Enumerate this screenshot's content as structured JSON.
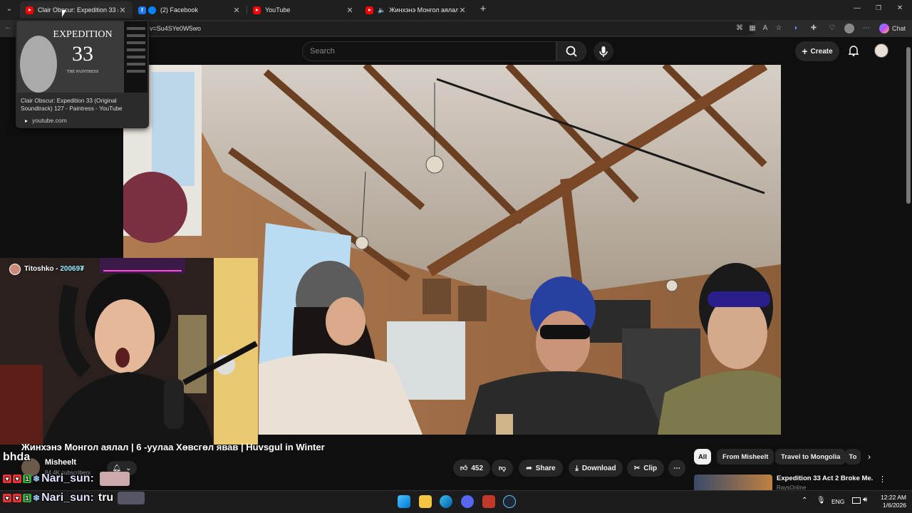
{
  "browser": {
    "tabs": [
      {
        "title": "Clair Obscur: Expedition 33 (Origin",
        "icon": "youtube-icon"
      },
      {
        "title": "(2) Facebook",
        "icon": "facebook-icon"
      },
      {
        "title": "YouTube",
        "icon": "youtube-icon"
      },
      {
        "title": "Жинхэнэ Монгол аялал | 6 -у",
        "icon": "youtube-icon",
        "audio": true
      }
    ],
    "url": "v=Su4SYe0W5wo",
    "chat_label": "Chat",
    "tab_preview": {
      "title": "Clair Obscur: Expedition 33 (Original Soundtrack) 127 - Paintress - YouTube",
      "domain": "youtube.com",
      "album_word": "EXPEDITION",
      "album_num": "33",
      "album_sub": "THE PAINTRESS"
    }
  },
  "youtube": {
    "search_placeholder": "Search",
    "create_label": "Create",
    "video_title": "Жинхэнэ Монгол аялал | 6 -уулаа Хөвсгөл явав | Huvsgul in Winter",
    "channel": "Misheelt",
    "subscribers": "84.4K subscribers",
    "likes": "452",
    "share_label": "Share",
    "download_label": "Download",
    "clip_label": "Clip",
    "chips": [
      "All",
      "From Misheelt",
      "Travel to Mongolia",
      "To"
    ],
    "recommended_title": "Expedition 33 Act 2 Broke Me.",
    "recommended_channel": "RaysOnline"
  },
  "stream": {
    "streamer": "Titoshko",
    "points": "20069₮",
    "chat": [
      {
        "text": "bhda"
      },
      {
        "user": "Nari_sun:",
        "text": ""
      },
      {
        "user": "Nari_sun:",
        "text": "tru"
      }
    ]
  },
  "taskbar": {
    "lang": "ENG",
    "time": "12:22 AM",
    "date": "1/6/2026"
  },
  "colors": {
    "youtube_red": "#ff0000",
    "facebook_blue": "#1877f2",
    "background": "#0f0f0f"
  }
}
